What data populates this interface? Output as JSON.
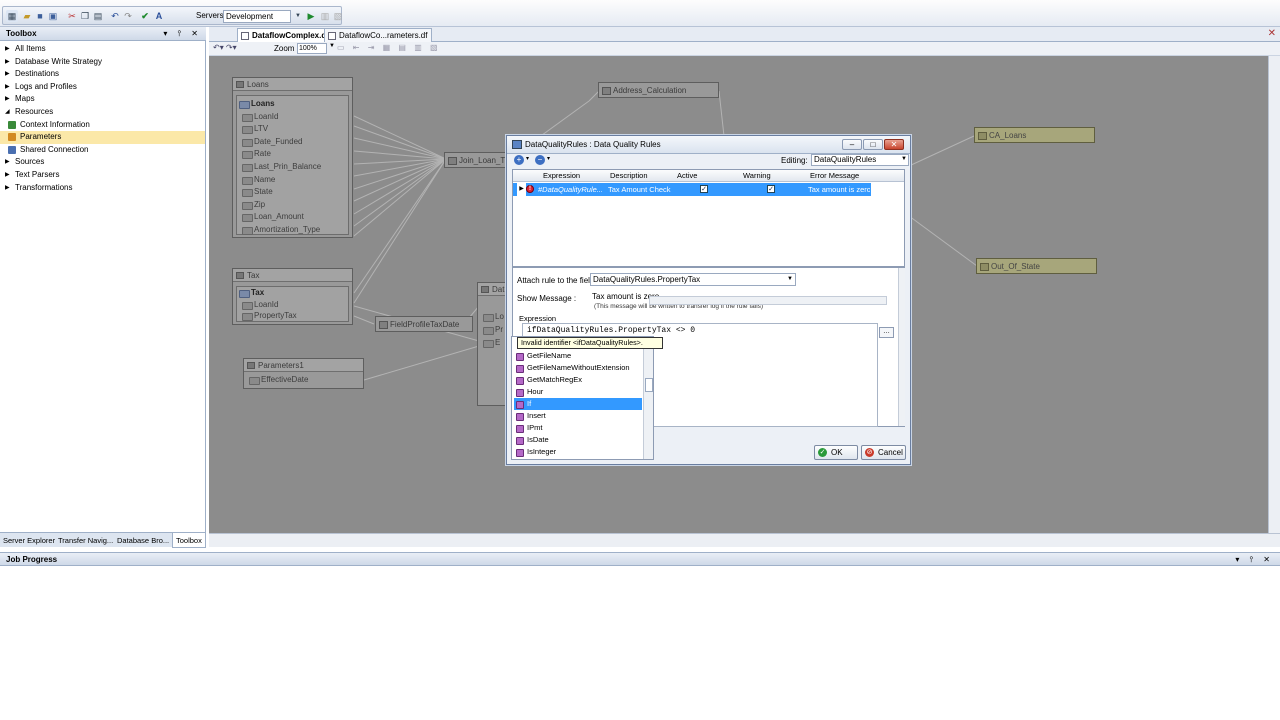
{
  "toolbar": {
    "servers_label": "Servers",
    "servers_value": "Development"
  },
  "toolbox": {
    "title": "Toolbox",
    "items": [
      {
        "label": "All Items"
      },
      {
        "label": "Database Write Strategy"
      },
      {
        "label": "Destinations"
      },
      {
        "label": "Logs and Profiles"
      },
      {
        "label": "Maps"
      },
      {
        "label": "Resources"
      },
      {
        "label": "Context Information"
      },
      {
        "label": "Parameters"
      },
      {
        "label": "Shared Connection"
      },
      {
        "label": "Sources"
      },
      {
        "label": "Text Parsers"
      },
      {
        "label": "Transformations"
      }
    ],
    "bottom_tabs": [
      "Server Explorer",
      "Transfer Navig...",
      "Database Bro...",
      "Toolbox"
    ]
  },
  "tabs": [
    {
      "label": "DataflowComplex.df"
    },
    {
      "label": "DataflowCo...rameters.df"
    }
  ],
  "canvas_toolbar": {
    "zoom_label": "Zoom",
    "zoom_value": "100%"
  },
  "canvas": {
    "loans": {
      "title": "Loans",
      "group": "Loans",
      "fields": [
        "LoanId",
        "LTV",
        "Date_Funded",
        "Rate",
        "Last_Prin_Balance",
        "Name",
        "State",
        "Zip",
        "Loan_Amount",
        "Amortization_Type"
      ]
    },
    "tax": {
      "title": "Tax",
      "group": "Tax",
      "fields": [
        "LoanId",
        "PropertyTax"
      ]
    },
    "parameters": {
      "title": "Parameters1",
      "fields": [
        "EffectiveDate"
      ]
    },
    "join_node": "Join_Loan_T",
    "fieldprofile_node": "FieldProfileTaxDate",
    "address_node": "Address_Calculation",
    "ca_loans": "CA_Loans",
    "out_of_state": "Out_Of_State",
    "partial_node": {
      "title": "Dat",
      "fields": [
        "Lo",
        "Pr",
        "E"
      ]
    }
  },
  "dialog": {
    "title": "DataQualityRules : Data Quality Rules",
    "editing_label": "Editing:",
    "editing_value": "DataQualityRules",
    "grid": {
      "headers": [
        "Expression",
        "Description",
        "Active",
        "Warning",
        "Error Message"
      ],
      "row": {
        "expression": "#DataQualityRule...",
        "description": "Tax Amount Check",
        "error_message": "Tax amount is zero"
      }
    },
    "attach_label": "Attach rule to the field:",
    "attach_value": "DataQualityRules.PropertyTax",
    "show_message_label": "Show Message :",
    "show_message_value": "Tax amount is zero",
    "show_message_note": "(This message will be written to transfer log if the rule fails)",
    "expression_label": "Expression",
    "expression_text": "ifDataQualityRules.PropertyTax <> 0",
    "tooltip": "Invalid identifier <ifDataQualityRules>.",
    "autocomplete": [
      "GetFileName",
      "GetFileNameWithoutExtension",
      "GetMatchRegEx",
      "Hour",
      "If",
      "Insert",
      "IPmt",
      "IsDate",
      "IsInteger"
    ],
    "ok_label": "OK",
    "cancel_label": "Cancel"
  },
  "job_progress": {
    "title": "Job Progress"
  }
}
